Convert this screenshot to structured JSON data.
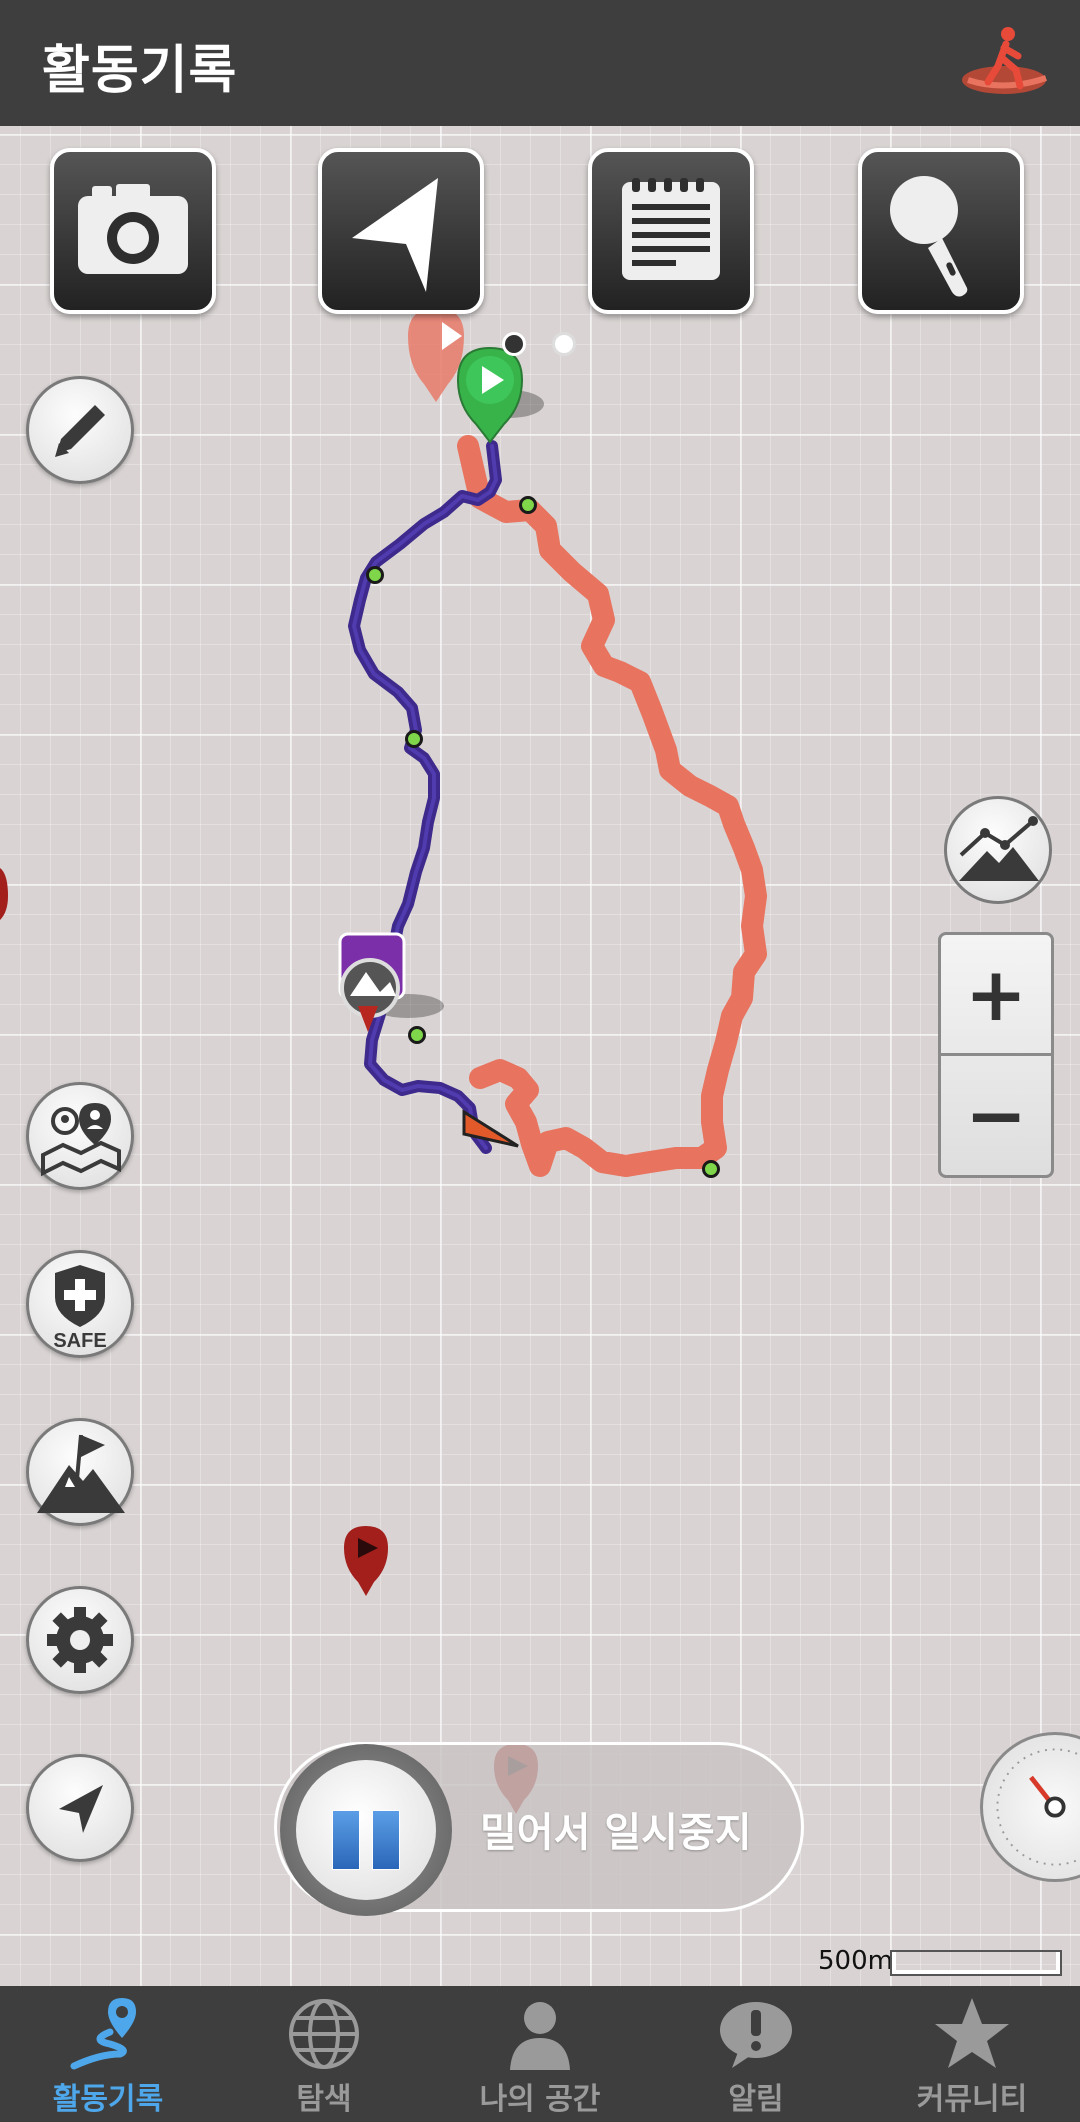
{
  "header": {
    "title": "활동기록"
  },
  "toolbar": {
    "icons": [
      "camera-icon",
      "navigation-arrow-icon",
      "notepad-icon",
      "microphone-icon"
    ]
  },
  "controls": {
    "pause_label": "밀어서 일시중지",
    "zoom_in": "+",
    "zoom_out": "−"
  },
  "map": {
    "scale_label": "500m",
    "route_colors": {
      "recorded": "#3d2a8c",
      "planned": "#e8735f"
    }
  },
  "tabs": [
    {
      "label": "활동기록",
      "icon": "route-pin-icon",
      "active": true
    },
    {
      "label": "탐색",
      "icon": "globe-icon",
      "active": false
    },
    {
      "label": "나의 공간",
      "icon": "person-icon",
      "active": false
    },
    {
      "label": "알림",
      "icon": "alert-bubble-icon",
      "active": false
    },
    {
      "label": "커뮤니티",
      "icon": "star-icon",
      "active": false
    }
  ]
}
